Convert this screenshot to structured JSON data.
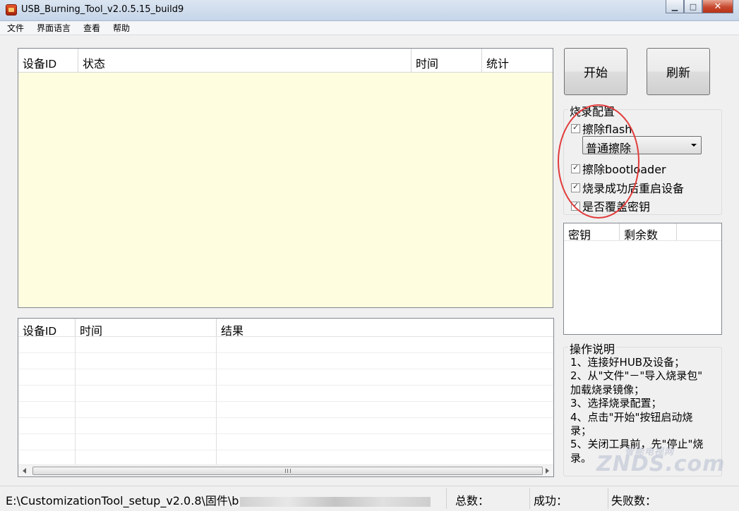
{
  "window": {
    "title": "USB_Burning_Tool_v2.0.5.15_build9",
    "min_label": "▁",
    "max_label": "□",
    "close_label": "✕"
  },
  "menu": [
    "文件",
    "界面语言",
    "查看",
    "帮助"
  ],
  "device_table": {
    "columns": [
      "设备ID",
      "状态",
      "时间",
      "统计"
    ],
    "rows": []
  },
  "result_table": {
    "columns": [
      "设备ID",
      "时间",
      "结果"
    ],
    "rows": [],
    "empty_row_count": 8,
    "scrollbar_grip": "III"
  },
  "buttons": {
    "start": "开始",
    "refresh": "刷新"
  },
  "burn_config": {
    "title": "烧录配置",
    "erase_flash": {
      "label": "擦除flash",
      "checked": true
    },
    "erase_mode": "普通擦除",
    "erase_bootloader": {
      "label": "擦除bootloader",
      "checked": true
    },
    "reboot_after": {
      "label": "烧录成功后重启设备",
      "checked": true
    },
    "overwrite_key": {
      "label": "是否覆盖密钥",
      "checked": true
    }
  },
  "key_table": {
    "columns": [
      "密钥",
      "剩余数"
    ]
  },
  "instructions": {
    "title": "操作说明",
    "lines": [
      "1、连接好HUB及设备；",
      "2、从\"文件\"－\"导入烧录包\"",
      "加载烧录镜像；",
      "3、选择烧录配置；",
      "4、点击\"开始\"按钮启动烧",
      "录；",
      "5、关闭工具前，先\"停止\"烧",
      "录。"
    ]
  },
  "statusbar": {
    "path": "E:\\CustomizationTool_setup_v2.0.8\\固件\\b",
    "total_label": "总数：",
    "success_label": "成功：",
    "fail_label": "失败数："
  },
  "watermark": {
    "top": "智能电视网",
    "main": "ZNDS.com"
  },
  "colors": {
    "device_table_bg": "#fffde0",
    "highlight": "#e23b3b"
  }
}
